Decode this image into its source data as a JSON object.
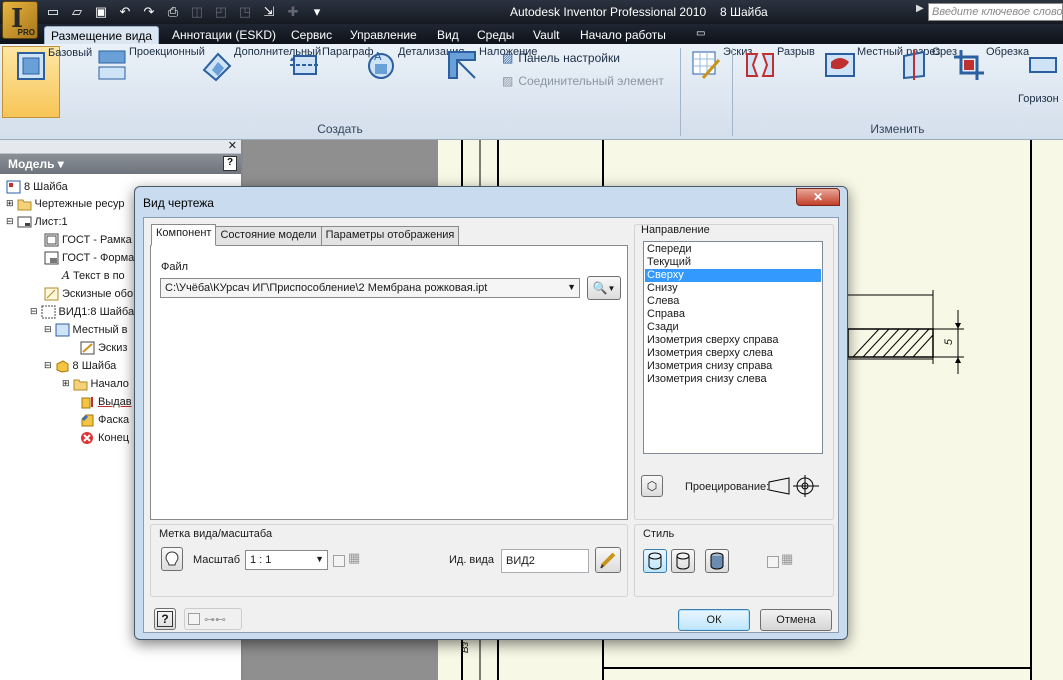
{
  "app": {
    "title": "Autodesk Inventor Professional 2010",
    "document": "8 Шайба",
    "logo_letter": "I",
    "logo_badge": "PRO",
    "search_placeholder": "Введите ключевое слово/фразу"
  },
  "quick_access": [
    "new-icon",
    "open-icon",
    "save-icon",
    "undo-icon",
    "redo-icon",
    "print-icon"
  ],
  "ribbon_tabs": [
    "Размещение вида",
    "Аннотации (ESKD)",
    "Сервис",
    "Управление",
    "Вид",
    "Среды",
    "Vault",
    "Начало работы"
  ],
  "ribbon": {
    "create_buttons": [
      "Базовый",
      "Проекционный",
      "Дополнительный",
      "Параграф",
      "Детализация",
      "Наложение"
    ],
    "small_buttons": [
      "Панель настройки",
      "Соединительный элемент"
    ],
    "sketch_button": "Эскиз",
    "modify_buttons": [
      "Разрыв",
      "Местный разрез",
      "Срез",
      "Обрезка",
      "Горизон"
    ],
    "group_create": "Создать",
    "group_modify": "Изменить"
  },
  "browser": {
    "header": "Модель",
    "items": [
      "8 Шайба",
      "Чертежные ресур",
      "Лист:1",
      "ГОСТ - Рамка",
      "ГОСТ - Форма",
      "Текст в по",
      "Эскизные обо",
      "ВИД1:8 Шайба",
      "Местный в",
      "Эскиз",
      "8 Шайба",
      "Начало",
      "Выдав",
      "Фаска",
      "Конец"
    ]
  },
  "drawing": {
    "dimension": "5",
    "side_letter": "Вз"
  },
  "dialog": {
    "title": "Вид чертежа",
    "close": "✕",
    "tabs": [
      "Компонент",
      "Состояние модели",
      "Параметры отображения"
    ],
    "file_label": "Файл",
    "file_path": "C:\\Учёба\\КУрсач ИГ\\Приспособление\\2 Мембрана рожковая.ipt",
    "direction_label": "Направление",
    "directions": [
      "Спереди",
      "Текущий",
      "Сверху",
      "Снизу",
      "Слева",
      "Справа",
      "Сзади",
      "Изометрия сверху справа",
      "Изометрия сверху слева",
      "Изометрия снизу справа",
      "Изометрия снизу слева"
    ],
    "selected_direction": "Сверху",
    "projection_label": "Проецирование:",
    "label_scale_group": "Метка вида/масштаба",
    "scale_label": "Масштаб",
    "scale_value": "1 : 1",
    "view_id_label": "Ид. вида",
    "view_id_value": "ВИД2",
    "style_label": "Стиль",
    "help": "?",
    "ok": "ОК",
    "cancel": "Отмена"
  }
}
